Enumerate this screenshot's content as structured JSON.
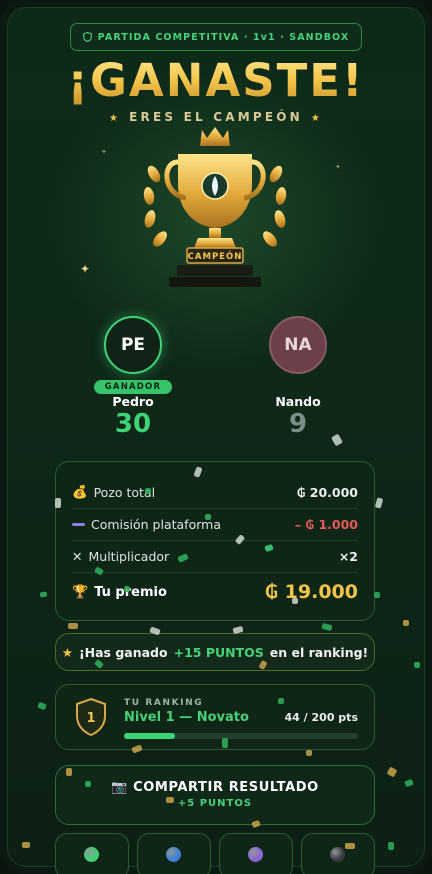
{
  "header": {
    "badge_icon": "shield-icon",
    "badge": "PARTIDA COMPETITIVA · 1v1 · SANDBOX"
  },
  "hero": {
    "title": "¡GANASTE!",
    "subtitle": "ERES EL CAMPEÓN",
    "trophy_plate": "CAMPEÓN"
  },
  "players": [
    {
      "initials": "PE",
      "tag": "GANADOR",
      "name": "Pedro",
      "score": "30",
      "color": "#3fd277"
    },
    {
      "initials": "NA",
      "name": "Nando",
      "score": "9",
      "color": "#7b8f86"
    }
  ],
  "prize": {
    "rows": [
      {
        "icon": "money-bag-icon",
        "emoji": "💰",
        "label": "Pozo total",
        "value": "₲ 20.000"
      },
      {
        "icon": "purple-bar-icon",
        "label": "Comisión plataforma",
        "value": "– ₲ 1.000"
      },
      {
        "icon": "close-icon",
        "emoji": "✕",
        "label": "Multiplicador",
        "value": "×2"
      },
      {
        "icon": "trophy-icon",
        "emoji": "🏆",
        "label": "Tu premio",
        "value": "₲ 19.000"
      }
    ]
  },
  "points_banner": {
    "prefix": "¡Has ganado",
    "highlight": "+15 PUNTOS",
    "suffix": "en el ranking!"
  },
  "ranking": {
    "shield_number": "1",
    "label": "TU RANKING",
    "level": "Nivel 1 — Novato",
    "points": "44 / 200 pts",
    "progress": 0.22
  },
  "share": {
    "label": "COMPARTIR RESULTADO",
    "bonus": "+5 PUNTOS"
  },
  "gems": [
    {
      "name": "green-gem-icon",
      "color": "#3fd277"
    },
    {
      "name": "blue-gem-icon",
      "color": "#3b7fd8"
    },
    {
      "name": "purple-gem-icon",
      "color": "#8a63d6"
    },
    {
      "name": "dark-gem-icon",
      "color": "#3a3a44"
    }
  ],
  "colors": {
    "accent": "#3fd277",
    "gold": "#f2c54a",
    "danger": "#e25a5a",
    "background": "#0d2a18"
  }
}
